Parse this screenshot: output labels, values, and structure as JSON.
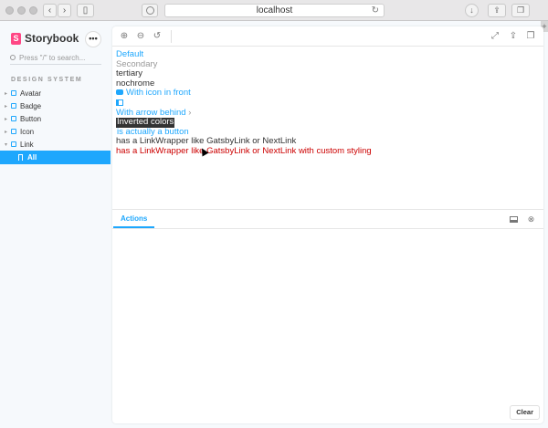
{
  "browser": {
    "url": "localhost"
  },
  "sidebar": {
    "brand": "Storybook",
    "menu_label": "•••",
    "search_placeholder": "Press \"/\" to search...",
    "section_title": "DESIGN SYSTEM",
    "items": [
      {
        "label": "Avatar"
      },
      {
        "label": "Badge"
      },
      {
        "label": "Button"
      },
      {
        "label": "Icon"
      },
      {
        "label": "Link"
      }
    ],
    "selected_story": "All"
  },
  "preview": {
    "links": {
      "default": "Default",
      "secondary": "Secondary",
      "tertiary": "tertiary",
      "nochrome": "nochrome",
      "with_icon": "With icon in front",
      "with_arrow": "With arrow behind",
      "arrow_glyph": "›",
      "inverted": "Inverted colors",
      "is_button": "is actually a button",
      "link_wrapper": "has a LinkWrapper like GatsbyLink or NextLink",
      "link_wrapper_custom": "has a LinkWrapper like GatsbyLink or NextLink with custom styling"
    }
  },
  "addons": {
    "tab_actions": "Actions",
    "clear_button": "Clear"
  },
  "colors": {
    "accent": "#1ea7fd",
    "brand": "#ff4785",
    "custom_link": "#cc0000"
  }
}
